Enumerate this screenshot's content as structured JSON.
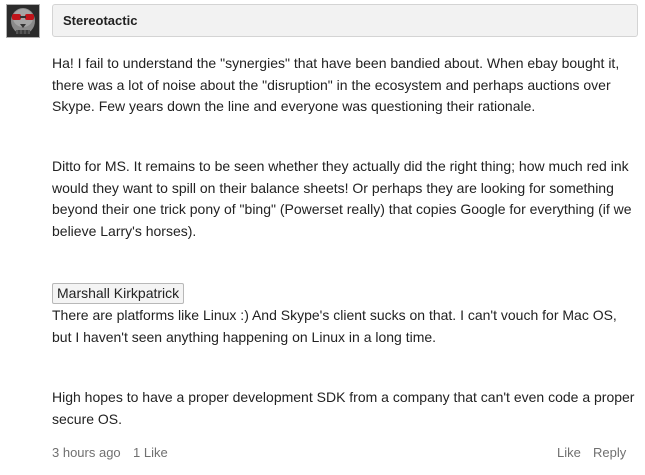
{
  "comment": {
    "author": "Stereotactic",
    "avatar_icon": "skull-avatar-icon",
    "paragraphs": [
      "Ha! I fail to understand the \"synergies\" that have been bandied about. When ebay bought it, there was a lot of noise about the \"disruption\" in the ecosystem and perhaps auctions over Skype. Few years down the line and everyone was questioning their rationale.",
      "Ditto for MS. It remains to be seen whether they actually did the right thing; how much red ink would they want to spill on their balance sheets! Or perhaps they are looking for something beyond their one trick pony of \"bing\" (Powerset really) that copies Google for everything (if we believe Larry's horses).",
      "There are platforms like Linux :) And Skype's client sucks on that. I can't vouch for Mac OS, but I haven't seen anything happening on Linux in a long time.",
      "High hopes to have a proper development SDK from a company that can't even code a proper secure OS."
    ],
    "mention": "Marshall Kirkpatrick",
    "timestamp": "3 hours ago",
    "likes": "1 Like",
    "like_label": "Like",
    "reply_label": "Reply"
  },
  "colors": {
    "author_bar_bg": "#f2f2f2",
    "author_bar_border": "#d4d4d4",
    "meta_text": "#707070",
    "body_text": "#222222"
  }
}
